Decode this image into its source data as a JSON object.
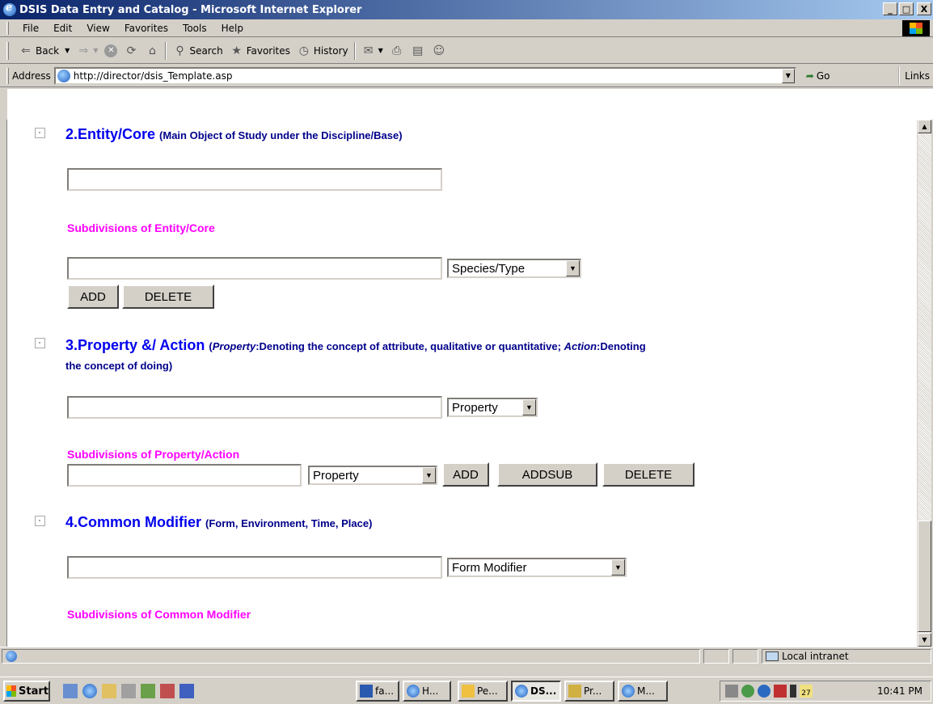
{
  "window": {
    "title": "DSIS Data Entry and Catalog - Microsoft Internet Explorer",
    "min": "_",
    "max": "□",
    "close": "X"
  },
  "menu": [
    "File",
    "Edit",
    "View",
    "Favorites",
    "Tools",
    "Help"
  ],
  "toolbar": {
    "back": "Back",
    "search": "Search",
    "favorites": "Favorites",
    "history": "History"
  },
  "address": {
    "label": "Address",
    "url": "http://director/dsis_Template.asp",
    "go": "Go",
    "links": "Links"
  },
  "form": {
    "entity": {
      "title": "2.Entity/Core",
      "desc": "(Main Object of Study under the Discipline/Base)",
      "value": "",
      "sub_label": "Subdivisions of Entity/Core",
      "sub_value": "",
      "sub_select": "Species/Type",
      "add": "ADD",
      "delete": "DELETE"
    },
    "property": {
      "title": "3.Property &/ Action",
      "desc_a_em": "Property",
      "desc_a": ":Denoting the concept of attribute, qualitative or quantitative; ",
      "desc_b_em": "Action",
      "desc_b": ":Denoting",
      "desc_c": "the concept of doing)",
      "value": "",
      "select": "Property",
      "sub_label": "Subdivisions of Property/Action",
      "sub_value": "",
      "sub_select": "Property",
      "add": "ADD",
      "addsub": "ADDSUB",
      "delete": "DELETE"
    },
    "modifier": {
      "title": "4.Common Modifier",
      "desc": "(Form, Environment, Time, Place)",
      "value": "",
      "select": "Form Modifier",
      "sub_label": "Subdivisions of Common Modifier"
    }
  },
  "status": {
    "zone": "Local intranet"
  },
  "taskbar": {
    "start": "Start",
    "tasks": [
      "fa...",
      "H...",
      "Pe...",
      "DS...",
      "Pr...",
      "M..."
    ],
    "active_task": 3,
    "clock": "10:41 PM",
    "tray_date": "27"
  }
}
